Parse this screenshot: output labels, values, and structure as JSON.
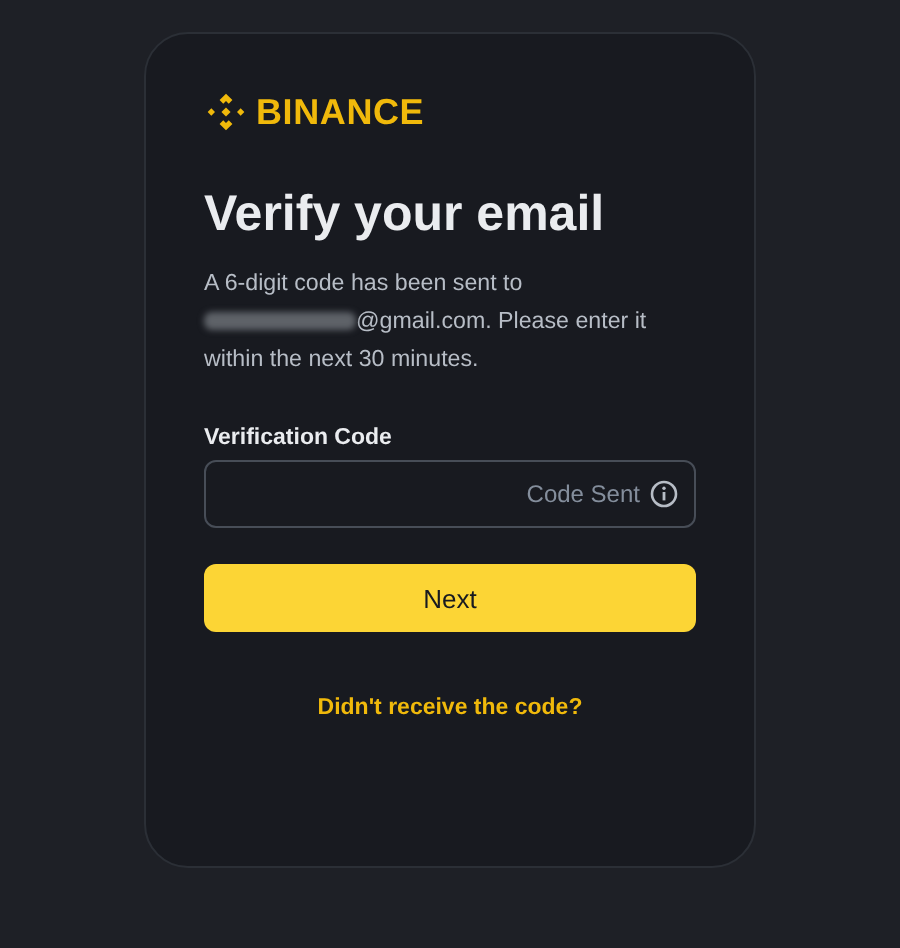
{
  "brand": {
    "name": "BINANCE"
  },
  "title": "Verify your email",
  "message": {
    "before": "A 6-digit code has been sent to",
    "email_redacted": true,
    "after": "@gmail.com. Please enter it",
    "last_line": "within the next 30 minutes."
  },
  "field": {
    "label": "Verification Code",
    "status": "Code Sent"
  },
  "button": "Next",
  "link": "Didn't receive the code?"
}
